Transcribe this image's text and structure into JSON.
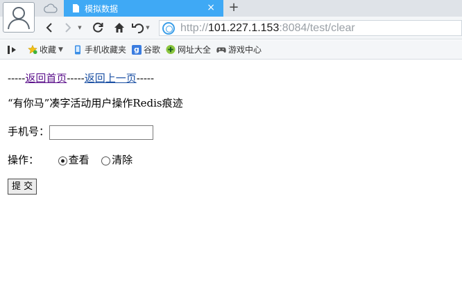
{
  "tab": {
    "title": "模拟数据",
    "close": "×",
    "new_tab": "+"
  },
  "address_bar": {
    "protocol": "http://",
    "host": "101.227.1.153",
    "rest": ":8084/test/clear"
  },
  "bookmarks": [
    {
      "label": "收藏",
      "icon": "star-icon"
    },
    {
      "label": "手机收藏夹",
      "icon": "phone-icon"
    },
    {
      "label": "谷歌",
      "icon": "google-icon"
    },
    {
      "label": "网址大全",
      "icon": "plus-circle-icon"
    },
    {
      "label": "游戏中心",
      "icon": "gamepad-icon"
    }
  ],
  "page": {
    "dashes_1": "-----",
    "link_home": "返回首页",
    "dashes_2": "-----",
    "link_back": "返回上一页",
    "dashes_3": "-----",
    "heading": "“有你马”凑字活动用户操作Redis痕迹",
    "phone_label": "手机号：",
    "phone_value": "",
    "operation_label": "操作：",
    "option_view": "查看",
    "option_clear": "清除",
    "submit_label": "提 交"
  },
  "colors": {
    "tab_active": "#3fa9f5",
    "link_visited": "#5a0f8a",
    "link": "#1a4fa3"
  }
}
